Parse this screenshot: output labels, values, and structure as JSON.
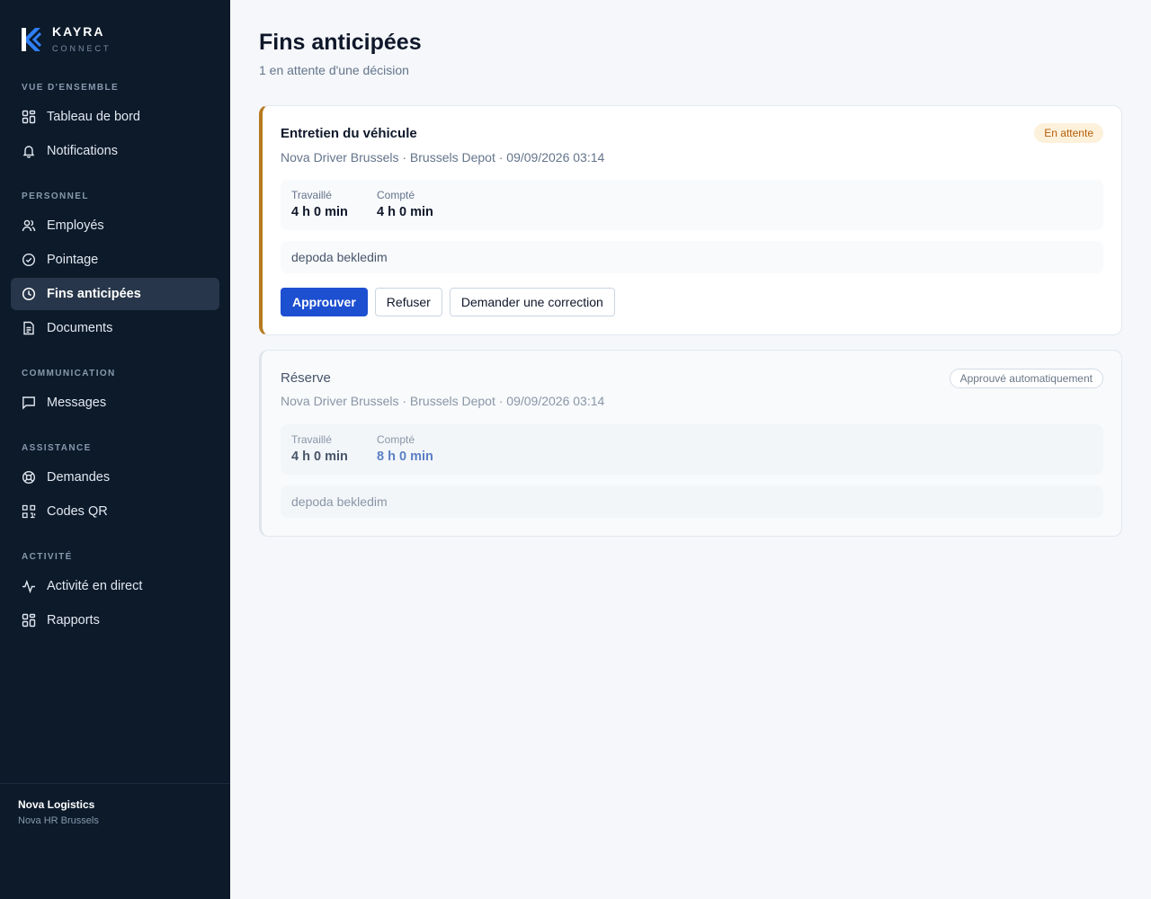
{
  "brand": {
    "name": "KAYRA",
    "sub": "CONNECT",
    "color": "#2f7ff7"
  },
  "sidebar": {
    "sections": [
      {
        "title": "VUE D'ENSEMBLE",
        "items": [
          {
            "label": "Tableau de bord",
            "icon": "dashboard-icon"
          },
          {
            "label": "Notifications",
            "icon": "bell-icon"
          }
        ]
      },
      {
        "title": "PERSONNEL",
        "items": [
          {
            "label": "Employés",
            "icon": "users-icon"
          },
          {
            "label": "Pointage",
            "icon": "check-circle-icon"
          },
          {
            "label": "Fins anticipées",
            "icon": "clock-icon",
            "active": true
          },
          {
            "label": "Documents",
            "icon": "document-icon"
          }
        ]
      },
      {
        "title": "COMMUNICATION",
        "items": [
          {
            "label": "Messages",
            "icon": "message-icon"
          }
        ]
      },
      {
        "title": "ASSISTANCE",
        "items": [
          {
            "label": "Demandes",
            "icon": "lifebuoy-icon"
          },
          {
            "label": "Codes QR",
            "icon": "qr-code-icon"
          }
        ]
      },
      {
        "title": "ACTIVITÉ",
        "items": [
          {
            "label": "Activité en direct",
            "icon": "activity-icon"
          },
          {
            "label": "Rapports",
            "icon": "reports-icon"
          }
        ]
      }
    ],
    "org": {
      "name": "Nova Logistics",
      "sub": "Nova HR Brussels"
    }
  },
  "page": {
    "title": "Fins anticipées",
    "subtitle": "1 en attente d'une décision"
  },
  "requests": [
    {
      "title": "Entretien du véhicule",
      "meta": "Nova Driver Brussels · Brussels Depot · 09/09/2026 03:14",
      "status": "En attente",
      "worked_label": "Travaillé",
      "worked_value": "4 h 0 min",
      "counted_label": "Compté",
      "counted_value": "4 h 0 min",
      "note": "depoda bekledim",
      "actions": {
        "approve": "Approuver",
        "reject": "Refuser",
        "correction": "Demander une correction"
      }
    },
    {
      "title": "Réserve",
      "meta": "Nova Driver Brussels · Brussels Depot · 09/09/2026 03:14",
      "status": "Approuvé automatiquement",
      "worked_label": "Travaillé",
      "worked_value": "4 h 0 min",
      "counted_label": "Compté",
      "counted_value": "8 h 0 min",
      "note": "depoda bekledim"
    }
  ],
  "colors": {
    "sidebar_bg": "#0c1a2a",
    "accent": "#1d4fd1",
    "pending": "#b7791f"
  }
}
